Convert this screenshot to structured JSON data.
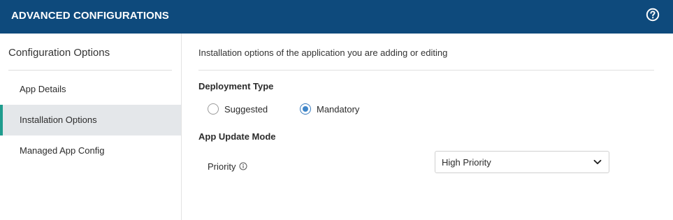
{
  "header": {
    "title": "ADVANCED CONFIGURATIONS",
    "help_icon": "question-circle-icon",
    "background": "#0e4a7c"
  },
  "sidebar": {
    "title": "Configuration Options",
    "items": [
      {
        "label": "App Details",
        "active": false
      },
      {
        "label": "Installation Options",
        "active": true
      },
      {
        "label": "Managed App Config",
        "active": false
      }
    ],
    "active_accent": "#1f9c8e"
  },
  "main": {
    "description": "Installation options of the application you are adding or editing",
    "deployment_type": {
      "label": "Deployment Type",
      "options": [
        {
          "label": "Suggested",
          "checked": false
        },
        {
          "label": "Mandatory",
          "checked": true
        }
      ]
    },
    "app_update_mode": {
      "label": "App Update Mode",
      "priority_label": "Priority",
      "priority_info_icon": "info-circle-icon",
      "priority_value": "High Priority",
      "chevron_icon": "chevron-down-icon"
    }
  }
}
